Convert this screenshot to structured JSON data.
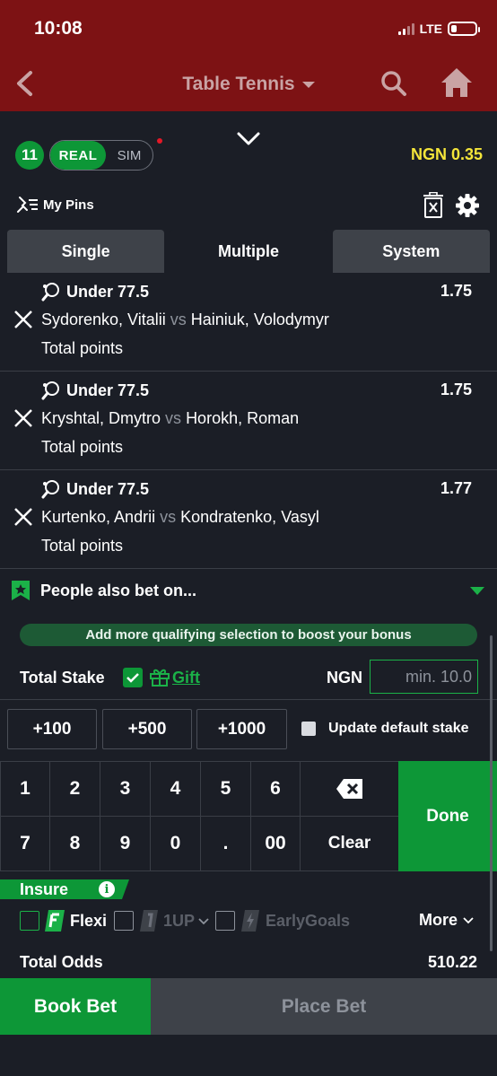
{
  "status": {
    "time": "10:08",
    "network": "LTE"
  },
  "header": {
    "title": "Table Tennis",
    "back_icon": "chevron-left-icon",
    "search_icon": "search-icon",
    "home_icon": "home-icon"
  },
  "betslip": {
    "count": "11",
    "mode_real": "REAL",
    "mode_sim": "SIM",
    "balance": "NGN 0.35",
    "pins_label": "My Pins",
    "tabs": [
      "Single",
      "Multiple",
      "System"
    ],
    "active_tab": "Multiple",
    "selections": [
      {
        "market": "Under 77.5",
        "odds": "1.75",
        "home": "Sydorenko, Vitalii",
        "vs": "vs",
        "away": "Hainiuk, Volodymyr",
        "type": "Total points"
      },
      {
        "market": "Under 77.5",
        "odds": "1.75",
        "home": "Kryshtal, Dmytro",
        "vs": "vs",
        "away": "Horokh, Roman",
        "type": "Total points"
      },
      {
        "market": "Under 77.5",
        "odds": "1.77",
        "home": "Kurtenko, Andrii",
        "vs": "vs",
        "away": "Kondratenko, Vasyl",
        "type": "Total points"
      }
    ],
    "also_bet_label": "People also bet on...",
    "boost_message": "Add more qualifying selection to boost your bonus",
    "total_stake_label": "Total Stake",
    "gift_label": "Gift",
    "currency": "NGN",
    "stake_placeholder": "min. 10.0",
    "quick_stakes": [
      "+100",
      "+500",
      "+1000"
    ],
    "update_default_label": "Update default stake",
    "keypad": {
      "row1": [
        "1",
        "2",
        "3",
        "4",
        "5",
        "6"
      ],
      "row2": [
        "7",
        "8",
        "9",
        "0",
        ".",
        "00"
      ],
      "clear": "Clear",
      "done": "Done"
    },
    "insure_label": "Insure",
    "options": {
      "flexi": "Flexi",
      "oneup": "1UP",
      "early": "EarlyGoals",
      "more": "More"
    },
    "total_odds_label": "Total Odds",
    "total_odds": "510.22",
    "book_bet": "Book Bet",
    "place_bet": "Place Bet"
  },
  "colors": {
    "header_bg": "#7d1214",
    "accent_green": "#0d9737",
    "balance_yellow": "#f4e53a",
    "panel_bg": "#1b1e26"
  }
}
